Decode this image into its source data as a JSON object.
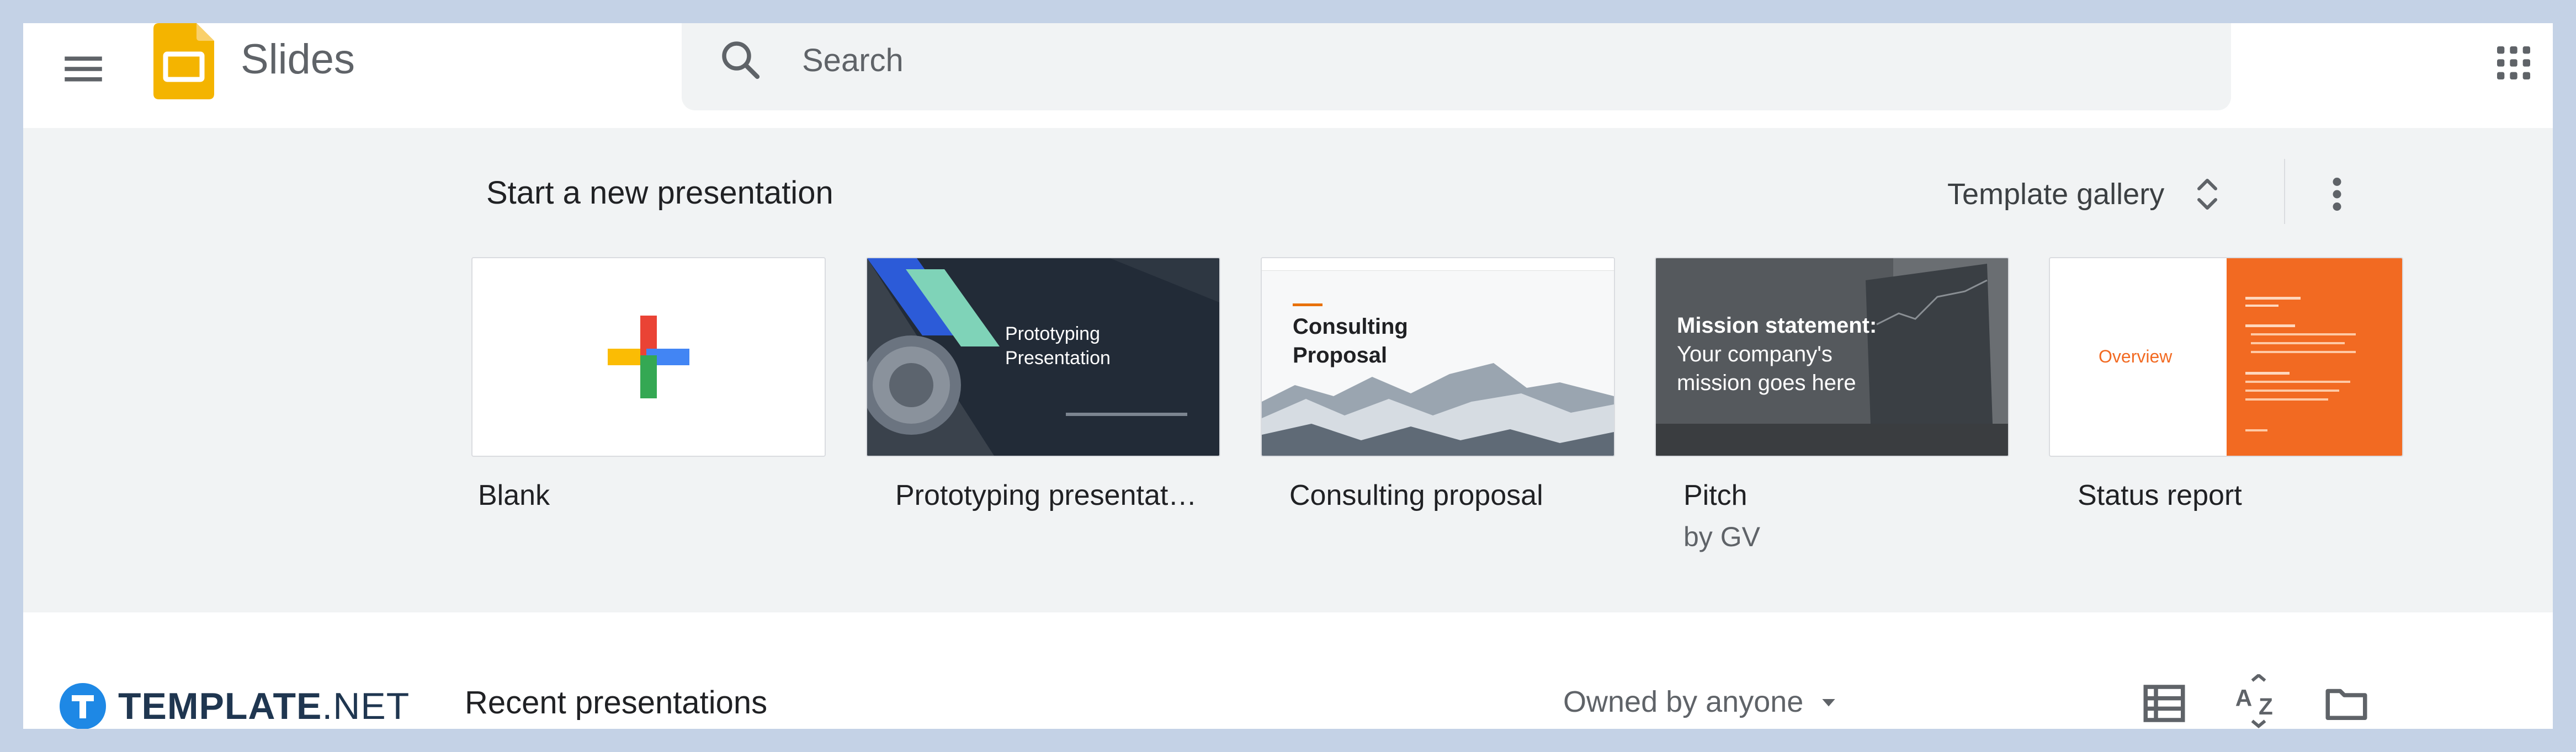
{
  "header": {
    "app_name": "Slides",
    "search_placeholder": "Search",
    "icons": {
      "menu": "hamburger-menu-icon",
      "logo": "google-slides-logo",
      "search": "search-icon",
      "apps": "google-apps-grid-icon"
    }
  },
  "new_section": {
    "title": "Start a new presentation",
    "template_gallery_label": "Template gallery",
    "templates": [
      {
        "label": "Blank"
      },
      {
        "label": "Prototyping presentat…",
        "thumb_title_line1": "Prototyping",
        "thumb_title_line2": "Presentation"
      },
      {
        "label": "Consulting proposal",
        "thumb_title_line1": "Consulting",
        "thumb_title_line2": "Proposal"
      },
      {
        "label": "Pitch",
        "sublabel": "by GV",
        "thumb_title_line1": "Mission statement:",
        "thumb_title_line2": "Your company's",
        "thumb_title_line3": "mission goes here"
      },
      {
        "label": "Status report",
        "thumb_title": "Overview"
      }
    ]
  },
  "recent_section": {
    "title": "Recent presentations",
    "owner_filter": "Owned by anyone"
  },
  "brand": {
    "name_strong": "TEMPLATE",
    "name_light": ".NET"
  },
  "colors": {
    "page_background": "#c4d2e6",
    "content_background": "#f1f3f4",
    "slides_yellow": "#f4b400",
    "google_red": "#ea4335",
    "google_blue": "#4285f4",
    "google_green": "#34a853",
    "google_yellow": "#fbbc04",
    "status_orange": "#f26a22",
    "brand_blue": "#1e88e5"
  }
}
